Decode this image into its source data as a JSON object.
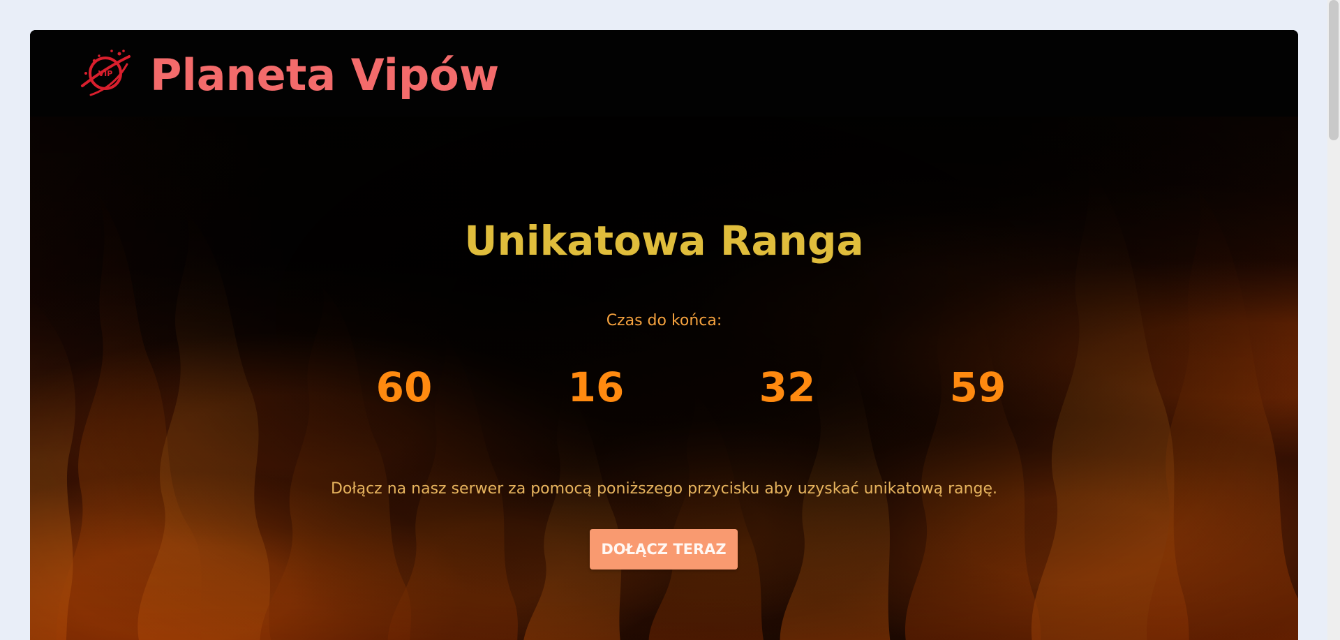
{
  "brand": {
    "name": "Planeta Vipów",
    "icon": "vip-planet-icon",
    "icon_text": "VIP"
  },
  "hero": {
    "title": "Unikatowa Ranga",
    "countdown_label": "Czas do końca:",
    "countdown": {
      "days": "60",
      "hours": "16",
      "minutes": "32",
      "seconds": "59"
    },
    "description": "Dołącz na nasz serwer za pomocą poniższego przycisku aby uzyskać unikatową rangę.",
    "button_label": "DOŁĄCZ TERAZ"
  },
  "colors": {
    "page_background": "#e9eef8",
    "card_background": "#020202",
    "brand": "#f36b6b",
    "title": "#e0bd3c",
    "countdown": "#ff8a10",
    "button": "#f99a70"
  }
}
